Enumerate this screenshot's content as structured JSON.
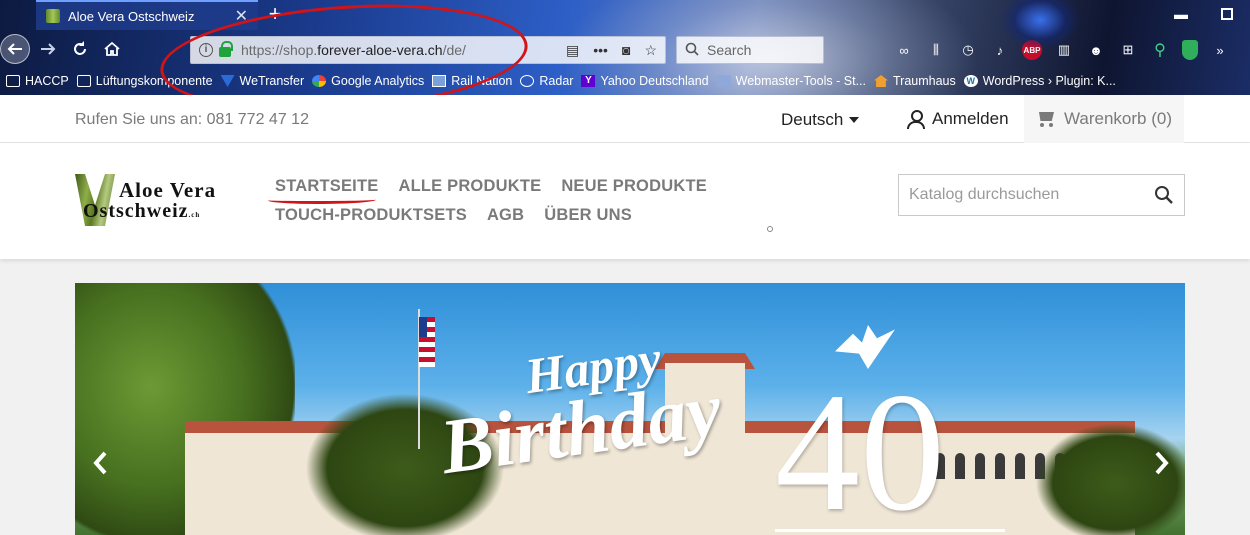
{
  "browser": {
    "tab_title": "Aloe Vera Ostschweiz",
    "tab_close": "✕",
    "new_tab": "+",
    "url_prefix": "https://shop.",
    "url_domain": "forever-aloe-vera.ch",
    "url_suffix": "/de/",
    "search_placeholder": "Search",
    "bookmarks": [
      {
        "label": "HACCP",
        "icon": "folder-icon"
      },
      {
        "label": "Lüftungskomponente",
        "icon": "folder-icon"
      },
      {
        "label": "WeTransfer",
        "icon": "wetransfer-icon"
      },
      {
        "label": "Google Analytics",
        "icon": "google-icon"
      },
      {
        "label": "Rail Nation",
        "icon": "rail-nation-icon"
      },
      {
        "label": "Radar",
        "icon": "globe-icon"
      },
      {
        "label": "Yahoo Deutschland",
        "icon": "yahoo-icon"
      },
      {
        "label": "Webmaster-Tools - St...",
        "icon": "webmaster-icon"
      },
      {
        "label": "Traumhaus",
        "icon": "house-icon"
      },
      {
        "label": "WordPress › Plugin: K...",
        "icon": "wordpress-icon"
      }
    ],
    "abp_label": "ABP",
    "yahoo_glyph": "Y",
    "wp_glyph": "W",
    "annotation_color": "#d01418"
  },
  "site": {
    "phone": "Rufen Sie uns an: 081 772 47 12",
    "language": "Deutsch",
    "login": "Anmelden",
    "cart": "Warenkorb (0)",
    "logo_line1": "Aloe Vera",
    "logo_line2": "Ostschweiz",
    "logo_suffix": ".ch",
    "menu_row1": [
      "STARTSEITE",
      "ALLE PRODUKTE",
      "NEUE PRODUKTE"
    ],
    "menu_row2": [
      "TOUCH-PRODUKTSETS",
      "AGB",
      "ÜBER UNS"
    ],
    "search_placeholder": "Katalog durchsuchen"
  },
  "hero": {
    "happy": "Happy",
    "birthday": "Birthday",
    "number": "40"
  }
}
